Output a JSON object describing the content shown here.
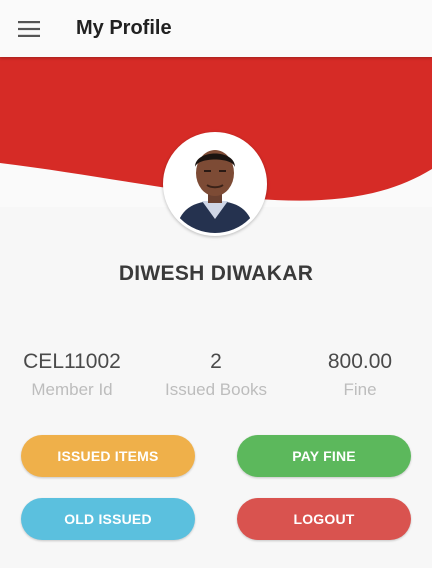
{
  "app_bar": {
    "title": "My Profile",
    "menu_icon": "hamburger-menu-icon"
  },
  "profile": {
    "name": "DIWESH DIWAKAR",
    "avatar": "user-photo"
  },
  "stats": [
    {
      "value": "CEL11002",
      "label": "Member Id"
    },
    {
      "value": "2",
      "label": "Issued Books"
    },
    {
      "value": "800.00",
      "label": "Fine"
    }
  ],
  "buttons": {
    "issued_items": "ISSUED ITEMS",
    "pay_fine": "PAY FINE",
    "old_issued": "OLD ISSUED",
    "logout": "LOGOUT"
  },
  "colors": {
    "banner_red": "#d62b26",
    "issued_items": "#efb04a",
    "pay_fine": "#5cb85c",
    "old_issued": "#5bc0de",
    "logout": "#d9534f"
  }
}
